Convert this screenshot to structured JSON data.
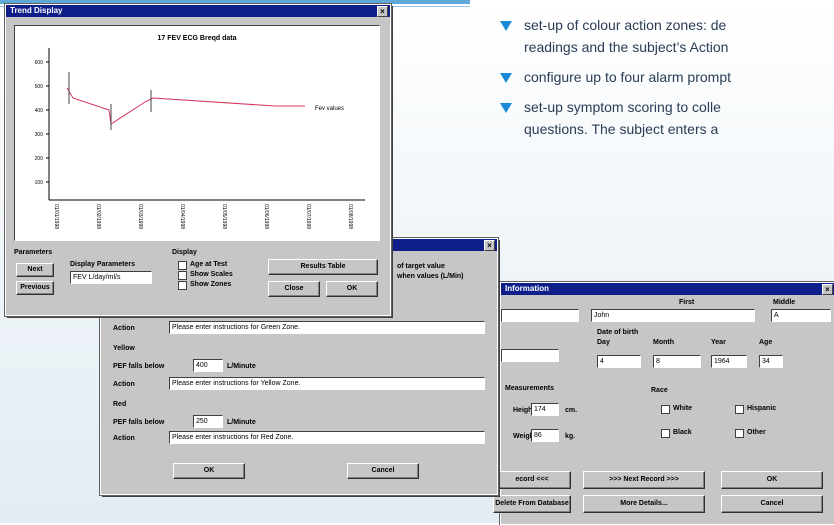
{
  "bullets": [
    "set-up of colour action zones: de",
    "readings and the subject’s Action",
    "configure up to four alarm prompt",
    "set-up symptom scoring to colle",
    "questions. The subject enters a"
  ],
  "trend_window": {
    "title": "Trend Display",
    "plot_title": "17 FEV ECG Breqd data",
    "series_label": "Fev values",
    "y_ticks": [
      "600",
      "500",
      "400",
      "300",
      "200",
      "100"
    ],
    "x_ticks": [
      "01/01/1998",
      "01/02/1998",
      "01/03/1998",
      "01/04/1998",
      "01/05/1998",
      "01/06/1998",
      "01/07/1998",
      "01/08/1998"
    ],
    "params_label": "Parameters",
    "btn_next": "Next",
    "btn_previous": "Previous",
    "display_params_label": "Display Parameters",
    "display_params_value": "FEV   L/day/ml/s",
    "display_label": "Display",
    "opt1": "Age at Test",
    "opt2": "Show Scales",
    "opt3": "Show Zones",
    "btn_results": "Results Table",
    "btn_close": "Close",
    "btn_ok": "OK"
  },
  "zones_window": {
    "title": "",
    "side1": "of target value",
    "side2": "when values (L/Min)",
    "green_action_label": "Action",
    "green_action": "Please enter instructions for Green Zone.",
    "yellow_title": "Yellow",
    "yellow_below_label": "PEF falls below",
    "yellow_value": "400",
    "yellow_unit": "L/Minute",
    "yellow_action_label": "Action",
    "yellow_action": "Please enter instructions for Yellow Zone.",
    "red_title": "Red",
    "red_below_label": "PEF falls below",
    "red_value": "250",
    "red_unit": "L/Minute",
    "red_action_label": "Action",
    "red_action": "Please enter instructions for Red Zone.",
    "btn_ok": "OK",
    "btn_cancel": "Cancel"
  },
  "demo_window": {
    "title": "Information",
    "first_label": "First",
    "middle_label": "Middle",
    "first_value": "John",
    "middle_value": "A",
    "dob_label": "Date of birth",
    "day_label": "Day",
    "month_label": "Month",
    "year_label": "Year",
    "age_label": "Age",
    "day_value": "4",
    "month_value": "8",
    "year_value": "1964",
    "age_value": "34",
    "measure_label": "Measurements",
    "height_label": "Height",
    "height_value": "174",
    "height_unit": "cm.",
    "weight_label": "Weight",
    "weight_value": "86",
    "weight_unit": "kg.",
    "race_label": "Race",
    "race_white": "White",
    "race_hispanic": "Hispanic",
    "race_black": "Black",
    "race_other": "Other",
    "btn_prev_record": "ecord <<<",
    "btn_next_record": ">>> Next Record >>>",
    "btn_ok": "OK",
    "btn_delete": "Delete From Database",
    "btn_more": "More Details...",
    "btn_cancel": "Cancel"
  }
}
